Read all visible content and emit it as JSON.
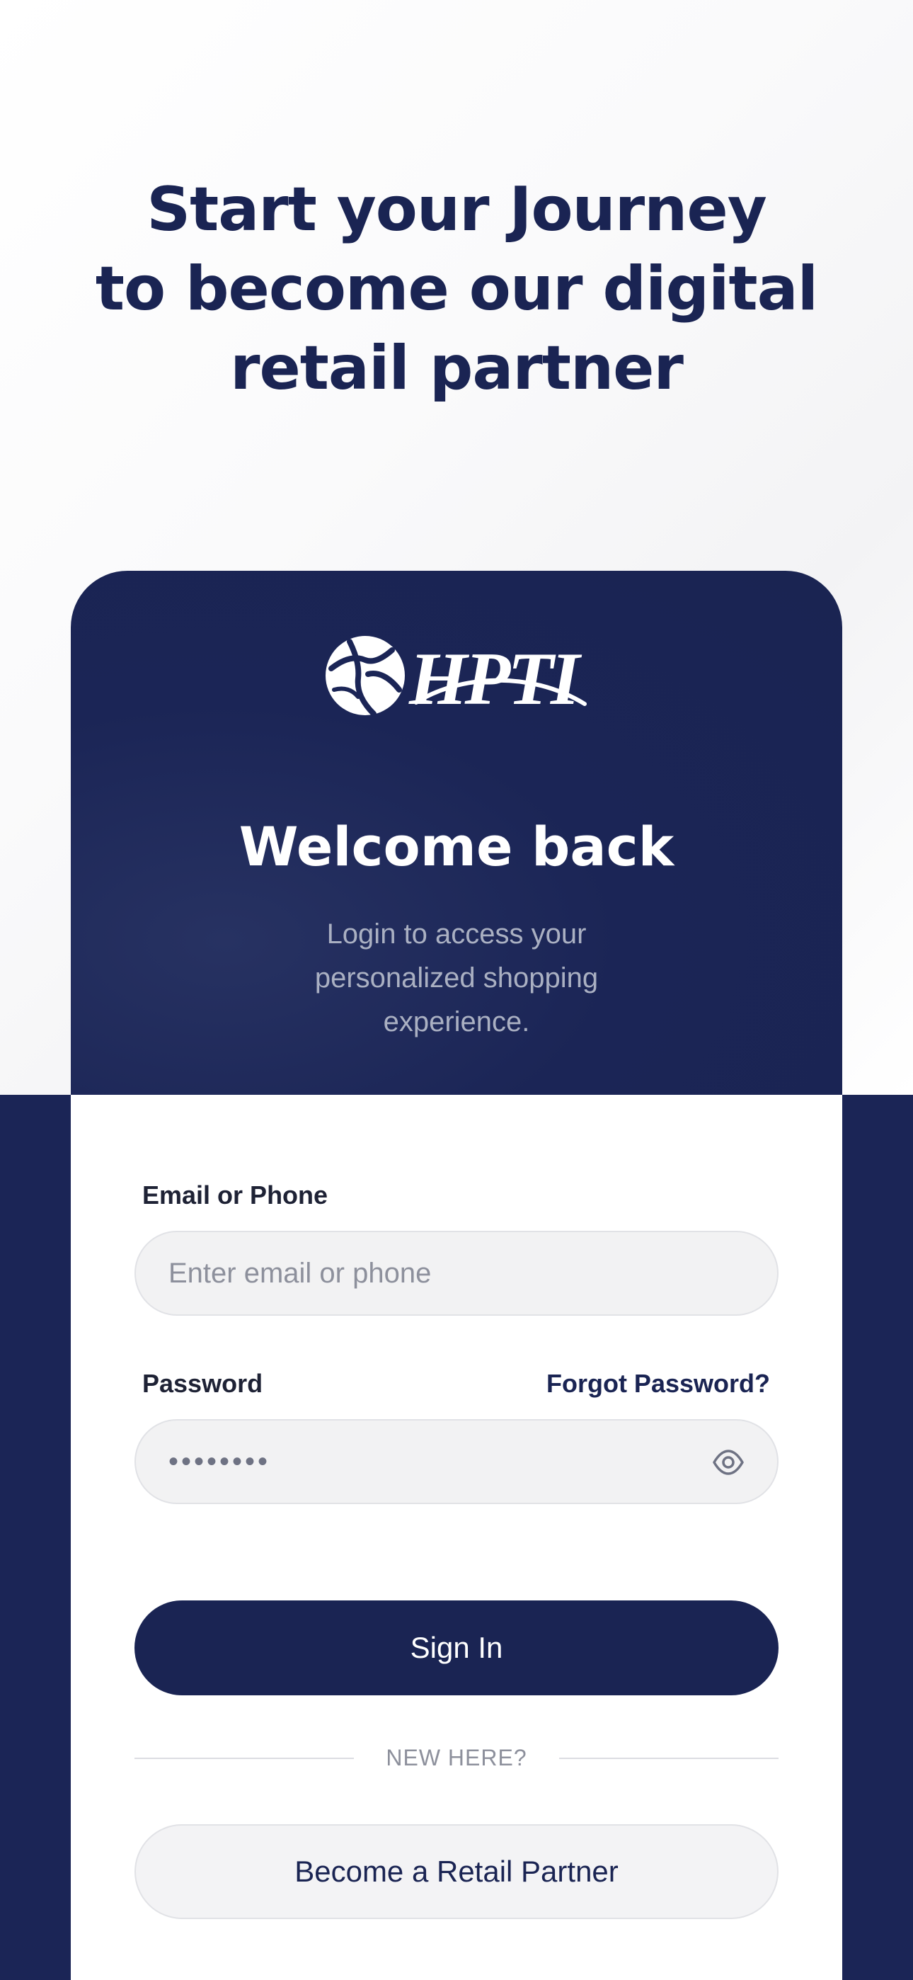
{
  "hero": {
    "line1": "Start your Journey",
    "line2": "to become our digital",
    "line3": "retail partner"
  },
  "brand": {
    "name": "HPTI",
    "logo_icon": "globe-icon"
  },
  "header": {
    "title": "Welcome back",
    "subtitle": "Login to access your personalized shopping experience."
  },
  "form": {
    "email": {
      "label": "Email or Phone",
      "placeholder": "Enter email or phone",
      "value": ""
    },
    "password": {
      "label": "Password",
      "value": "••••••••",
      "visibility_icon": "eye-icon"
    },
    "forgot_password": "Forgot Password?",
    "sign_in": "Sign In",
    "divider": "NEW HERE?",
    "become_partner": "Become a Retail Partner"
  },
  "colors": {
    "primary": "#1a2453",
    "background": "#ffffff",
    "muted_text": "#8d909c",
    "input_background": "#f2f2f3"
  }
}
